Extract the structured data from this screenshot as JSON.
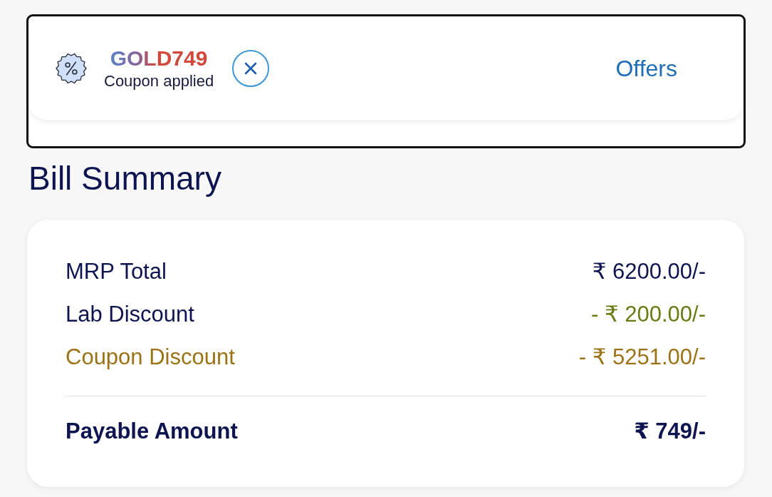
{
  "coupon_bar": {
    "code": "GOLD749",
    "status": "Coupon applied",
    "offers_link": "Offers"
  },
  "bill_summary": {
    "title": "Bill Summary",
    "rows": [
      {
        "label": "MRP Total",
        "value": "₹ 6200.00/-",
        "kind": "charge"
      },
      {
        "label": "Lab Discount",
        "value": "- ₹ 200.00/-",
        "kind": "discount"
      },
      {
        "label": "Coupon Discount",
        "value": "- ₹ 5251.00/-",
        "kind": "coupon"
      }
    ],
    "total": {
      "label": "Payable Amount",
      "value": "₹ 749/-"
    }
  }
}
